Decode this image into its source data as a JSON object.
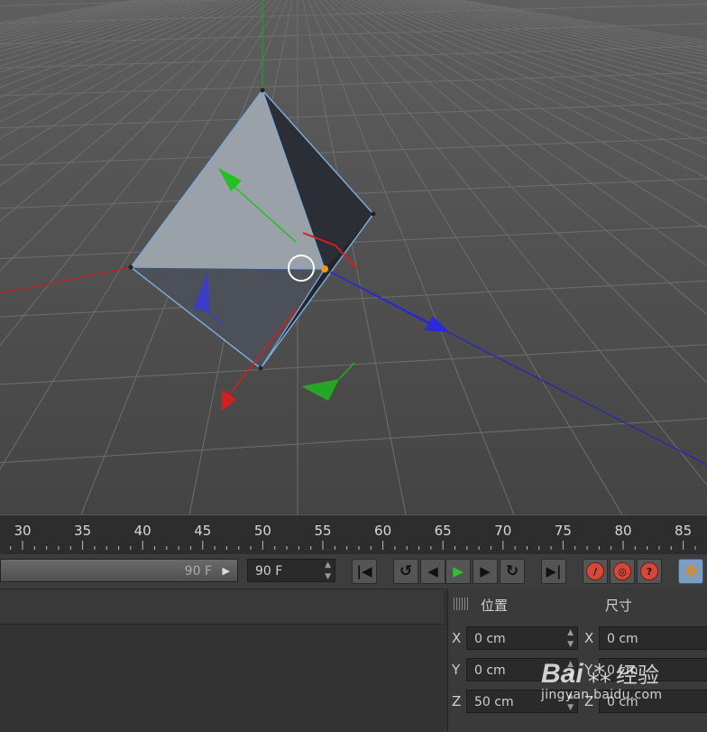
{
  "viewport": {
    "grid_color": "#707070",
    "face_light": "#9aa0a8",
    "face_dark": "#2c2f36",
    "edge_color": "#7fa8d8",
    "axis_x_color": "#d22020",
    "axis_y_color": "#20b020",
    "axis_z_color": "#2020d8"
  },
  "timeline": {
    "ticks": [
      "30",
      "35",
      "40",
      "45",
      "50",
      "55",
      "60",
      "65",
      "70",
      "75",
      "80",
      "85"
    ]
  },
  "transport": {
    "end_frame_slider": "90 F",
    "end_frame_field": "90 F",
    "buttons": [
      "skip-to-start",
      "prev-key",
      "prev-frame",
      "play",
      "next-frame",
      "next-key",
      "skip-to-end"
    ]
  },
  "coords": {
    "position_label": "位置",
    "size_label": "尺寸",
    "rows": [
      {
        "axis": "X",
        "position": "0 cm",
        "size": "0 cm"
      },
      {
        "axis": "Y",
        "position": "0 cm",
        "size": "0 cm"
      },
      {
        "axis": "Z",
        "position": "50 cm",
        "size": "0 cm"
      }
    ]
  },
  "watermark": {
    "brand": "Bai",
    "brand2": "经验",
    "url": "jingyan.baidu.com"
  }
}
